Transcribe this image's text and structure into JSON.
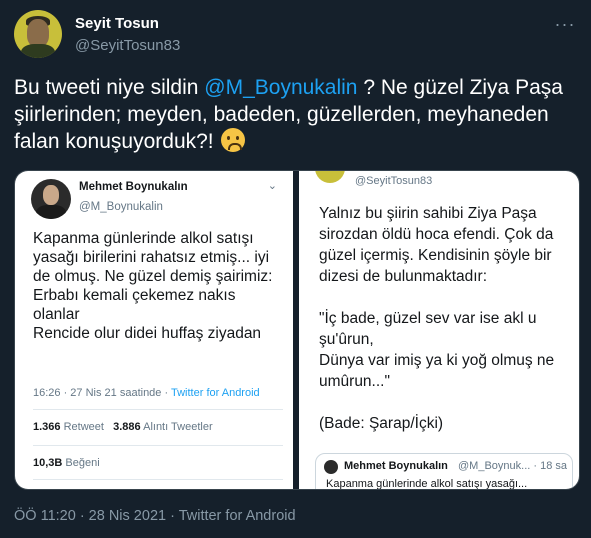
{
  "author": {
    "name": "Seyit Tosun",
    "handle": "@SeyitTosun83"
  },
  "tweet": {
    "text_part1": "Bu tweeti niye sildin ",
    "mention": "@M_Boynukalin",
    "text_part2": " ? Ne güzel Ziya Paşa şiirlerinden; meyden, badeden, güzellerden, meyhaneden falan konuşuyorduk?! ",
    "emoji": "frowning-face"
  },
  "media": {
    "left": {
      "name": "Mehmet Boynukalın",
      "handle": "@M_Boynukalin",
      "body": "Kapanma günlerinde alkol satışı yasağı birilerini rahatsız etmiş... iyi de olmuş. Ne güzel demiş şairimiz:\nErbabı kemali çekemez nakıs olanlar\nRencide olur didei huffaş ziyadan",
      "time": "16:26 · 27 Nis 21 saatinde · ",
      "source": "Twitter for Android",
      "retweets_count": "1.366",
      "retweets_label": " Retweet",
      "quotes_count": "3.886",
      "quotes_label": " Alıntı Tweetler",
      "likes_count": "10,3B",
      "likes_label": " Beğeni"
    },
    "right": {
      "handle": "@SeyitTosun83",
      "body": "Yalnız bu şiirin sahibi Ziya Paşa sirozdan öldü hoca efendi. Çok da güzel içermiş. Kendisinin şöyle bir dizesi de bulunmaktadır:\n\n\"İç bade, güzel sev var ise akl u şu'ûrun,\nDünya var imiş ya ki yoğ olmuş ne umûrun...\"\n\n(Bade: Şarap/İçki)",
      "quote_name": "Mehmet Boynukalın",
      "quote_handle": "@M_Boynuk... · 18 sa",
      "quote_text": "Kapanma günlerinde alkol satışı yasağı..."
    }
  },
  "footer": {
    "meta": "ÖÖ 11:20 · 28 Nis 2021 · Twitter for Android"
  }
}
